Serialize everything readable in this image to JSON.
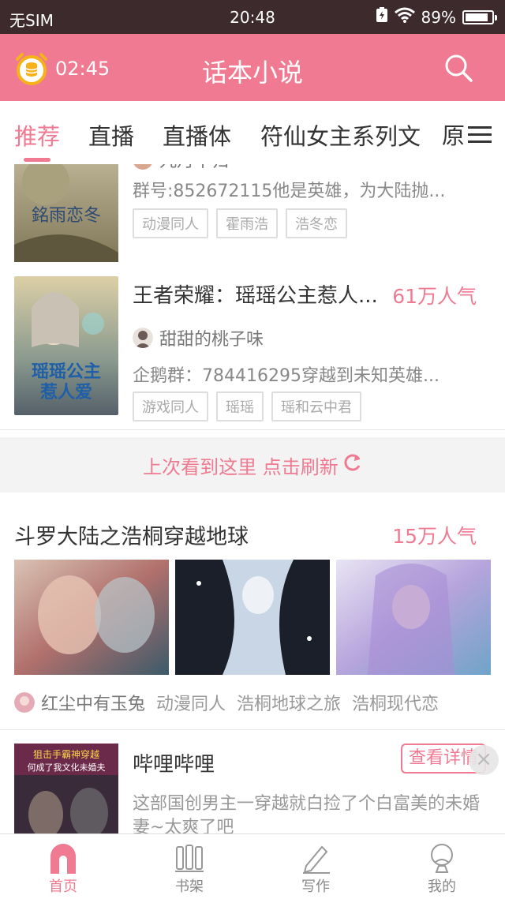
{
  "status_bar": {
    "carrier": "无SIM",
    "time": "20:48",
    "battery": "89%",
    "battery_level": 0.89
  },
  "header": {
    "timer": "02:45",
    "title": "话本小说"
  },
  "tabs": {
    "items": [
      "推荐",
      "直播",
      "直播体",
      "符仙女主系列文"
    ],
    "partial": "原"
  },
  "books": [
    {
      "author": "九月不归",
      "desc": "群号:852672115他是英雄，为大陆抛...",
      "tags": [
        "动漫同人",
        "霍雨浩",
        "浩冬恋"
      ]
    },
    {
      "title": "王者荣耀：瑶瑶公主惹人...",
      "popularity": "61万人气",
      "author": "甜甜的桃子味",
      "desc": "企鹅群：784416295穿越到未知英雄...",
      "tags": [
        "游戏同人",
        "瑶瑶",
        "瑶和云中君"
      ]
    }
  ],
  "refresh": {
    "label": "上次看到这里 点击刷新"
  },
  "group": {
    "title": "斗罗大陆之浩桐穿越地球",
    "popularity": "15万人气",
    "author": "红尘中有玉兔",
    "tags": [
      "动漫同人",
      "浩桐地球之旅",
      "浩桐现代恋"
    ]
  },
  "ad": {
    "title": "哔哩哔哩",
    "detail": "查看详情",
    "desc": "这部国创男主一穿越就白捡了个白富美的未婚妻~太爽了吧"
  },
  "bottom_nav": [
    "首页",
    "书架",
    "写作",
    "我的"
  ],
  "colors": {
    "accent": "#ef7a92",
    "statusbar": "#3d2a2d"
  }
}
